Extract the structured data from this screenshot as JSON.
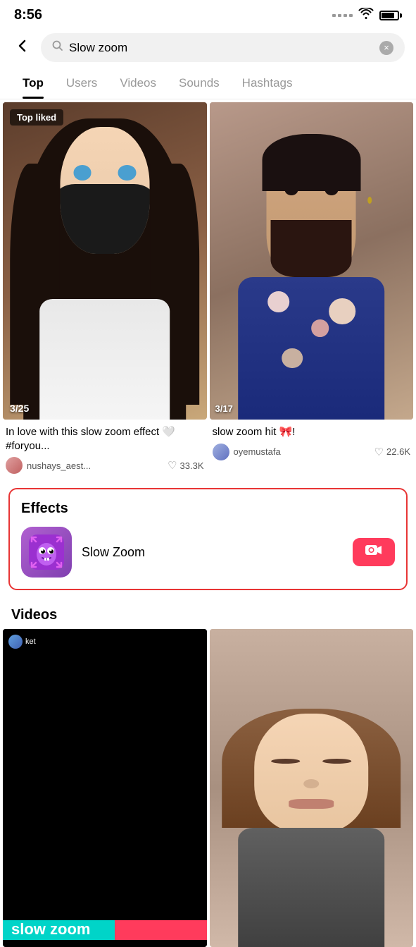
{
  "statusBar": {
    "time": "8:56",
    "batteryLevel": "75"
  },
  "searchBar": {
    "query": "Slow zoom",
    "placeholder": "Search",
    "backLabel": "←",
    "clearLabel": "×"
  },
  "tabs": [
    {
      "id": "top",
      "label": "Top",
      "active": true
    },
    {
      "id": "users",
      "label": "Users",
      "active": false
    },
    {
      "id": "videos",
      "label": "Videos",
      "active": false
    },
    {
      "id": "sounds",
      "label": "Sounds",
      "active": false
    },
    {
      "id": "hashtags",
      "label": "Hashtags",
      "active": false
    }
  ],
  "topVideos": [
    {
      "id": "v1",
      "badge": "Top liked",
      "counter": "3/25",
      "title": "In love with this slow zoom effect 🤍 #foryou...",
      "author": "nushays_aest...",
      "likes": "33.3K"
    },
    {
      "id": "v2",
      "counter": "3/17",
      "title": "slow zoom hit 🎀!",
      "author": "oyemustafa",
      "likes": "22.6K"
    }
  ],
  "effectsSection": {
    "title": "Effects",
    "item": {
      "name": "Slow Zoom",
      "iconEmoji": "👾",
      "buttonLabel": "🎥"
    }
  },
  "videosSection": {
    "title": "Videos",
    "items": [
      {
        "id": "bv1",
        "authorBadge": "ket",
        "overlayText": "slow zoom"
      },
      {
        "id": "bv2"
      }
    ]
  }
}
